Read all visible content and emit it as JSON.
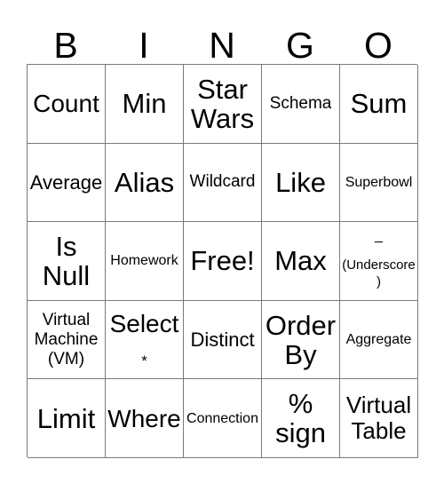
{
  "card": {
    "title": "BINGO",
    "header_letters": [
      "B",
      "I",
      "N",
      "G",
      "O"
    ],
    "colors": {
      "background": "#ffffff",
      "text": "#000000",
      "border": "#7a7a7a"
    },
    "rows": [
      [
        {
          "label": "Count",
          "size": "xl"
        },
        {
          "label": "Min",
          "size": "xxl"
        },
        {
          "label": "Star\nWars",
          "size": "xxl"
        },
        {
          "label": "Schema",
          "size": "sm"
        },
        {
          "label": "Sum",
          "size": "xxl"
        }
      ],
      [
        {
          "label": "Average",
          "size": "md"
        },
        {
          "label": "Alias",
          "size": "xxl"
        },
        {
          "label": "Wildcard",
          "size": "sm"
        },
        {
          "label": "Like",
          "size": "xxl"
        },
        {
          "label": "Superbowl",
          "size": "xs"
        }
      ],
      [
        {
          "label": "Is\nNull",
          "size": "xxl"
        },
        {
          "label": "Homework",
          "size": "xs"
        },
        {
          "label": "Free!",
          "size": "xxl",
          "free_space": true
        },
        {
          "label": "Max",
          "size": "xxl"
        },
        {
          "label": "_\n(Underscore)",
          "size": "xxs",
          "glyph": "_",
          "caption": "(Underscore)"
        }
      ],
      [
        {
          "label": "Virtual\nMachine\n(VM)",
          "size": "sm"
        },
        {
          "label": "Select\n*",
          "size": "xl",
          "main": "Select",
          "sub": "*"
        },
        {
          "label": "Distinct",
          "size": "md"
        },
        {
          "label": "Order\nBy",
          "size": "xxl"
        },
        {
          "label": "Aggregate",
          "size": "xs"
        }
      ],
      [
        {
          "label": "Limit",
          "size": "xxl"
        },
        {
          "label": "Where",
          "size": "xl"
        },
        {
          "label": "Connection",
          "size": "xs"
        },
        {
          "label": "%\nsign",
          "size": "xxl"
        },
        {
          "label": "Virtual\nTable",
          "size": "lg"
        }
      ]
    ]
  }
}
